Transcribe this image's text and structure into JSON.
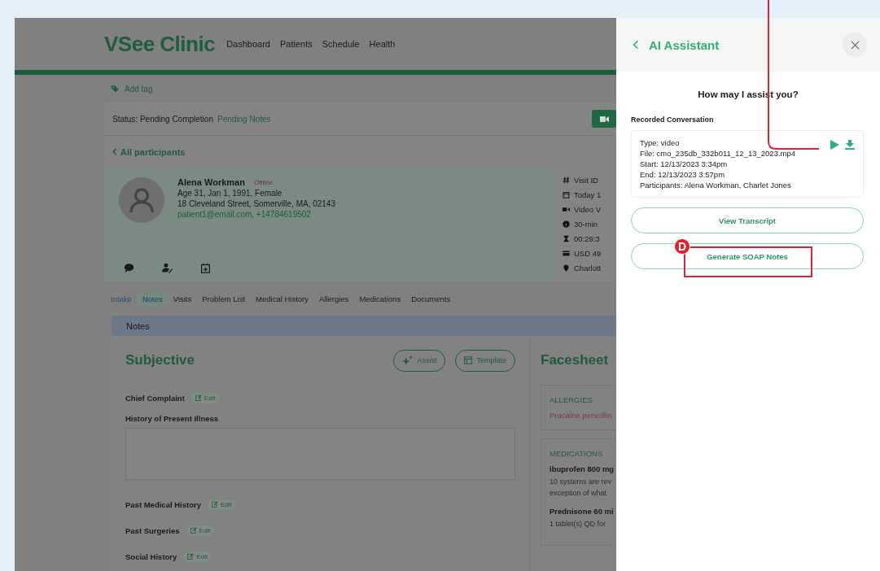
{
  "header": {
    "logo": "VSee Clinic",
    "nav": [
      "Dashboard",
      "Patients",
      "Schedule",
      "Health"
    ]
  },
  "add_tag": "Add tag",
  "status": {
    "label": "Status: Pending Completion",
    "value": "Pending Notes"
  },
  "back_link": "All participants",
  "patient": {
    "name": "Alena Workman",
    "presence": "Offline",
    "details": [
      "Age 31, Jan 1, 1991, Female",
      "18 Cleveland Street, Somerville, MA, 02143"
    ],
    "contact": "patient1@email.com, +14784619502"
  },
  "visit_info": [
    {
      "kind": "hash",
      "text": "Visit ID"
    },
    {
      "kind": "calendar",
      "text": "Today 1"
    },
    {
      "kind": "video",
      "text": "Video V"
    },
    {
      "kind": "info",
      "text": "30-min"
    },
    {
      "kind": "hourglass",
      "text": "00:29:3"
    },
    {
      "kind": "card",
      "text": "USD 49"
    },
    {
      "kind": "pin",
      "text": "Charlott"
    }
  ],
  "tabs": [
    {
      "label": "Intake",
      "selected": false
    },
    {
      "label": "Notes",
      "selected": true
    },
    {
      "label": "Visits",
      "selected": false
    },
    {
      "label": "Problem List",
      "selected": false
    },
    {
      "label": "Medical History",
      "selected": false
    },
    {
      "label": "Allergies",
      "selected": false
    },
    {
      "label": "Medications",
      "selected": false
    },
    {
      "label": "Documents",
      "selected": false
    }
  ],
  "notes_bar": "Notes",
  "subjective": {
    "title": "Subjective",
    "assist": "Assist",
    "template": "Template",
    "fields": [
      {
        "label": "Chief Complaint",
        "kind": "edit",
        "button": "Edit"
      },
      {
        "label": "History of Present Illness",
        "kind": "textarea"
      },
      {
        "label": "Past Medical History",
        "kind": "edit",
        "button": "Edit"
      },
      {
        "label": "Past Surgeries",
        "kind": "edit",
        "button": "Edit"
      },
      {
        "label": "Social History",
        "kind": "edit",
        "button": "Edit"
      }
    ]
  },
  "facesheet": {
    "title": "Facesheet",
    "sections": [
      {
        "heading": "ALLERGIES",
        "items": [
          {
            "kind": "alert",
            "name": "Procaine penicillin"
          }
        ]
      },
      {
        "heading": "MEDICATIONS",
        "items": [
          {
            "kind": "med",
            "name": "ibuprofen 800 mg",
            "note": "10 systems are rev exception of what"
          },
          {
            "kind": "med",
            "name": "Prednisone 60 mi",
            "note": "1 tablet(s) QD for"
          }
        ]
      }
    ]
  },
  "assistant": {
    "title": "AI Assistant",
    "prompt": "How may I assist you?",
    "section": "Recorded Conversation",
    "recording": [
      "Type: video",
      "File: cmo_235db_332b011_12_13_2023.mp4",
      "Start: 12/13/2023 3:34pm",
      "End: 12/13/2023 3:57pm",
      "Participants: Alena Workman, Charlet Jones"
    ],
    "buttons": [
      "View Transcript",
      "Generate SOAP Notes"
    ]
  },
  "callout": {
    "label": "D"
  }
}
